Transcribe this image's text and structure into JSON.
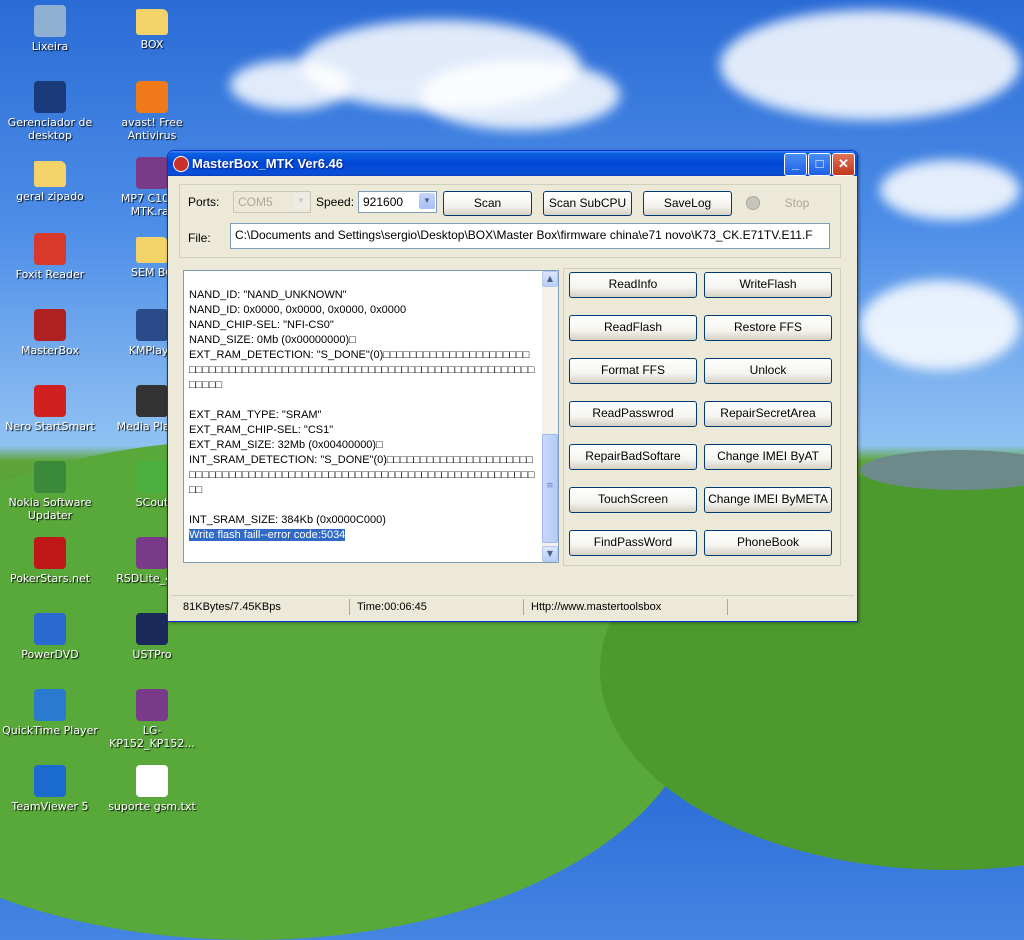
{
  "desktop": {
    "icons": [
      {
        "label": "Lixeira",
        "icon": "recycle-bin-icon",
        "color": "#8fb0d0"
      },
      {
        "label": "BOX",
        "icon": "folder-icon",
        "color": "#f5d36b"
      },
      {
        "label": "Gerenciador de desktop",
        "icon": "blackberry-icon",
        "color": "#1a3a7a"
      },
      {
        "label": "avast! Free Antivirus",
        "icon": "avast-icon",
        "color": "#f07a1a"
      },
      {
        "label": "geral zipado",
        "icon": "folder-icon",
        "color": "#f5d36b"
      },
      {
        "label": "MP7 C1000 MTK.rar",
        "icon": "winrar-icon",
        "color": "#7a3a8a"
      },
      {
        "label": "Foxit Reader",
        "icon": "foxit-icon",
        "color": "#d8392a"
      },
      {
        "label": "SEM BC",
        "icon": "folder-icon",
        "color": "#f5d36b"
      },
      {
        "label": "MasterBox",
        "icon": "masterbox-icon",
        "color": "#b02020"
      },
      {
        "label": "KMPlaye",
        "icon": "kmplayer-icon",
        "color": "#2a4a8a"
      },
      {
        "label": "Nero StartSmart",
        "icon": "nero-icon",
        "color": "#d02020"
      },
      {
        "label": "Media Player",
        "icon": "media-player-icon",
        "color": "#333333"
      },
      {
        "label": "Nokia Software Updater",
        "icon": "nokia-icon",
        "color": "#3a8a3a"
      },
      {
        "label": "SCout",
        "icon": "scout-icon",
        "color": "#4ab040"
      },
      {
        "label": "PokerStars.net",
        "icon": "pokerstars-icon",
        "color": "#c01818"
      },
      {
        "label": "RSDLite_4[1]",
        "icon": "winrar-icon",
        "color": "#7a3a8a"
      },
      {
        "label": "PowerDVD",
        "icon": "powerdvd-icon",
        "color": "#2a6ad0"
      },
      {
        "label": "USTPro",
        "icon": "ustpro-icon",
        "color": "#1a2a5a"
      },
      {
        "label": "QuickTime Player",
        "icon": "quicktime-icon",
        "color": "#2a7ad0"
      },
      {
        "label": "LG-KP152_KP152...",
        "icon": "winrar-icon",
        "color": "#7a3a8a"
      },
      {
        "label": "TeamViewer 5",
        "icon": "teamviewer-icon",
        "color": "#1a6ad0"
      },
      {
        "label": "suporte gsm.txt",
        "icon": "text-file-icon",
        "color": "#ffffff"
      }
    ]
  },
  "window": {
    "title": "MasterBox_MTK Ver6.46",
    "controls": {
      "minimize": "_",
      "maximize": "□",
      "close": "✕"
    },
    "top": {
      "ports_label": "Ports:",
      "ports_value": "COM5",
      "speed_label": "Speed:",
      "speed_value": "921600",
      "scan": "Scan",
      "scan_subcpu": "Scan SubCPU",
      "savelog": "SaveLog",
      "stop": "Stop",
      "file_label": "File:",
      "file_value": "C:\\Documents and Settings\\sergio\\Desktop\\BOX\\Master Box\\firmware china\\e71 novo\\K73_CK.E71TV.E11.F"
    },
    "log_lines": [
      "NAND_ID: \"NAND_UNKNOWN\"",
      "NAND_ID: 0x0000, 0x0000, 0x0000, 0x0000",
      "NAND_CHIP-SEL: \"NFI-CS0\"",
      "NAND_SIZE: 0Mb (0x00000000)□",
      "EXT_RAM_DETECTION: \"S_DONE\"(0)□□□□□□□□□□□□□□□□□□□□□□□□□□□□□□□□□□□□□□□□□□□□□□□□□□□□□□□□□□□□□□□□□□□□□□□□□□□□□□□",
      "",
      "EXT_RAM_TYPE: \"SRAM\"",
      "EXT_RAM_CHIP-SEL: \"CS1\"",
      "EXT_RAM_SIZE: 32Mb (0x00400000)□",
      "INT_SRAM_DETECTION: \"S_DONE\"(0)□□□□□□□□□□□□□□□□□□□□□□□□□□□□□□□□□□□□□□□□□□□□□□□□□□□□□□□□□□□□□□□□□□□□□□□□□□□□",
      "",
      "INT_SRAM_SIZE: 384Kb (0x0000C000)"
    ],
    "log_selected": "Write flash faill--error code:5034",
    "scroll": {
      "up": "▲",
      "down": "▼",
      "grip": "≡"
    },
    "actions": [
      [
        "ReadInfo",
        "WriteFlash"
      ],
      [
        "ReadFlash",
        "Restore FFS"
      ],
      [
        "Format FFS",
        "Unlock"
      ],
      [
        "ReadPasswrod",
        "RepairSecretArea"
      ],
      [
        "RepairBadSoftare",
        "Change IMEI ByAT"
      ],
      [
        "TouchScreen",
        "Change IMEI ByMETA"
      ],
      [
        "FindPassWord",
        "PhoneBook"
      ]
    ],
    "status": {
      "speed": "81KBytes/7.45KBps",
      "time": "Time:00:06:45",
      "url": "Http://www.mastertoolsbox"
    }
  }
}
